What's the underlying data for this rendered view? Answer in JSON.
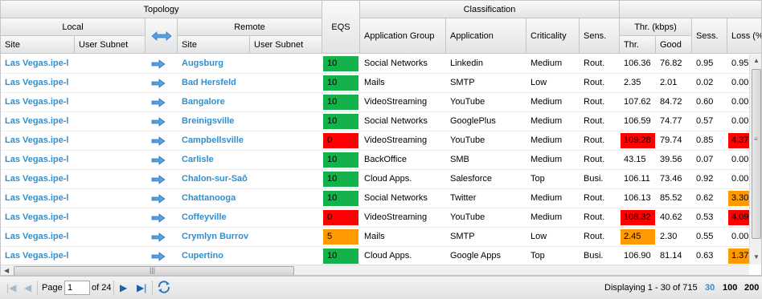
{
  "colors": {
    "green": "#13b24a",
    "red": "#ff0000",
    "orange": "#ff9a00",
    "link": "#2f8fd0"
  },
  "header": {
    "topology": "Topology",
    "local": "Local",
    "remote": "Remote",
    "site": "Site",
    "user_subnet": "User Subnet",
    "remote_site": "Site",
    "remote_user_subnet": "User Subnet",
    "eqs": "EQS",
    "classification": "Classification",
    "application_group": "Application Group",
    "application": "Application",
    "criticality": "Criticality",
    "sens": "Sens.",
    "thr_kbps": "Thr. (kbps)",
    "thr": "Thr.",
    "good": "Good",
    "sess": "Sess.",
    "loss": "Loss (%"
  },
  "rows": [
    {
      "local_site": "Las Vegas.ipe-l",
      "remote_site": "Augsburg",
      "eqs": "10",
      "eqs_color": "green",
      "app_group": "Social Networks",
      "app": "Linkedin",
      "crit": "Medium",
      "sens": "Rout.",
      "thr": "106.36",
      "thr_color": "",
      "good": "76.82",
      "sess": "0.95",
      "loss": "0.95",
      "loss_color": ""
    },
    {
      "local_site": "Las Vegas.ipe-l",
      "remote_site": "Bad Hersfeld",
      "eqs": "10",
      "eqs_color": "green",
      "app_group": "Mails",
      "app": "SMTP",
      "crit": "Low",
      "sens": "Rout.",
      "thr": "2.35",
      "thr_color": "",
      "good": "2.01",
      "sess": "0.02",
      "loss": "0.00",
      "loss_color": ""
    },
    {
      "local_site": "Las Vegas.ipe-l",
      "remote_site": "Bangalore",
      "eqs": "10",
      "eqs_color": "green",
      "app_group": "VideoStreaming",
      "app": "YouTube",
      "crit": "Medium",
      "sens": "Rout.",
      "thr": "107.62",
      "thr_color": "",
      "good": "84.72",
      "sess": "0.60",
      "loss": "0.00",
      "loss_color": ""
    },
    {
      "local_site": "Las Vegas.ipe-l",
      "remote_site": "Breinigsville",
      "eqs": "10",
      "eqs_color": "green",
      "app_group": "Social Networks",
      "app": "GooglePlus",
      "crit": "Medium",
      "sens": "Rout.",
      "thr": "106.59",
      "thr_color": "",
      "good": "74.77",
      "sess": "0.57",
      "loss": "0.00",
      "loss_color": ""
    },
    {
      "local_site": "Las Vegas.ipe-l",
      "remote_site": "Campbellsville",
      "eqs": "0",
      "eqs_color": "red",
      "app_group": "VideoStreaming",
      "app": "YouTube",
      "crit": "Medium",
      "sens": "Rout.",
      "thr": "109.28",
      "thr_color": "red",
      "good": "79.74",
      "sess": "0.85",
      "loss": "4.37",
      "loss_color": "red"
    },
    {
      "local_site": "Las Vegas.ipe-l",
      "remote_site": "Carlisle",
      "eqs": "10",
      "eqs_color": "green",
      "app_group": "BackOffice",
      "app": "SMB",
      "crit": "Medium",
      "sens": "Rout.",
      "thr": "43.15",
      "thr_color": "",
      "good": "39.56",
      "sess": "0.07",
      "loss": "0.00",
      "loss_color": ""
    },
    {
      "local_site": "Las Vegas.ipe-l",
      "remote_site": "Chalon-sur-Saô",
      "eqs": "10",
      "eqs_color": "green",
      "app_group": "Cloud Apps.",
      "app": "Salesforce",
      "crit": "Top",
      "sens": "Busi.",
      "thr": "106.11",
      "thr_color": "",
      "good": "73.46",
      "sess": "0.92",
      "loss": "0.00",
      "loss_color": ""
    },
    {
      "local_site": "Las Vegas.ipe-l",
      "remote_site": "Chattanooga",
      "eqs": "10",
      "eqs_color": "green",
      "app_group": "Social Networks",
      "app": "Twitter",
      "crit": "Medium",
      "sens": "Rout.",
      "thr": "106.13",
      "thr_color": "",
      "good": "85.52",
      "sess": "0.62",
      "loss": "3.30",
      "loss_color": "orange"
    },
    {
      "local_site": "Las Vegas.ipe-l",
      "remote_site": "Coffeyville",
      "eqs": "0",
      "eqs_color": "red",
      "app_group": "VideoStreaming",
      "app": "YouTube",
      "crit": "Medium",
      "sens": "Rout.",
      "thr": "108.32",
      "thr_color": "red",
      "good": "40.62",
      "sess": "0.53",
      "loss": "4.09",
      "loss_color": "red"
    },
    {
      "local_site": "Las Vegas.ipe-l",
      "remote_site": "Crymlyn Burrov",
      "eqs": "5",
      "eqs_color": "orange",
      "app_group": "Mails",
      "app": "SMTP",
      "crit": "Low",
      "sens": "Rout.",
      "thr": "2.45",
      "thr_color": "orange",
      "good": "2.30",
      "sess": "0.55",
      "loss": "0.00",
      "loss_color": ""
    },
    {
      "local_site": "Las Vegas.ipe-l",
      "remote_site": "Cupertino",
      "eqs": "10",
      "eqs_color": "green",
      "app_group": "Cloud Apps.",
      "app": "Google Apps",
      "crit": "Top",
      "sens": "Busi.",
      "thr": "106.90",
      "thr_color": "",
      "good": "81.14",
      "sess": "0.63",
      "loss": "1.37",
      "loss_color": "orange"
    }
  ],
  "pager": {
    "page_label": "Page",
    "page_value": "1",
    "of_label": "of 24",
    "displaying": "Displaying 1 - 30 of 715",
    "sizes": [
      "30",
      "100",
      "200"
    ],
    "active_size": "30"
  }
}
